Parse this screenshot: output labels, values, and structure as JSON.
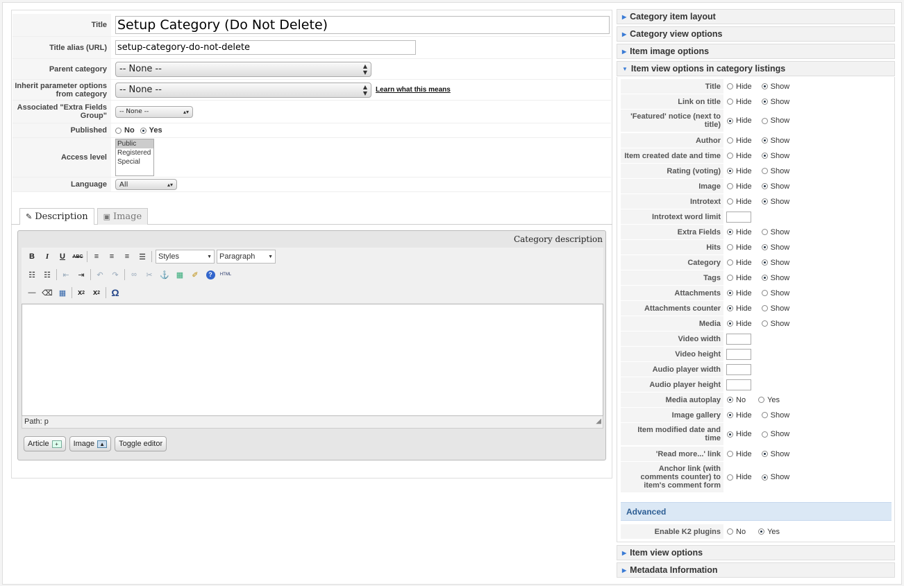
{
  "form": {
    "title_label": "Title",
    "title_value": "Setup Category (Do Not Delete)",
    "alias_label": "Title alias (URL)",
    "alias_value": "setup-category-do-not-delete",
    "parent_label": "Parent category",
    "parent_value": "-- None --",
    "inherit_label": "Inherit parameter options from category",
    "inherit_value": "-- None --",
    "learn_link": "Learn what this means",
    "extra_label": "Associated \"Extra Fields Group\"",
    "extra_value": "-- None --",
    "published_label": "Published",
    "published_no": "No",
    "published_yes": "Yes",
    "access_label": "Access level",
    "access_options": [
      "Public",
      "Registered",
      "Special"
    ],
    "language_label": "Language",
    "language_value": "All"
  },
  "tabs": {
    "description": "Description",
    "image": "Image"
  },
  "editor": {
    "heading": "Category description",
    "styles": "Styles",
    "format": "Paragraph",
    "path": "Path: p",
    "btn_article": "Article",
    "btn_image": "Image",
    "btn_toggle": "Toggle editor",
    "html_label": "HTML",
    "omega": "Ω"
  },
  "panels": {
    "item_layout": "Category item layout",
    "view_options": "Category view options",
    "image_options": "Item image options",
    "listing_options": "Item view options in category listings",
    "item_view": "Item view options",
    "metadata": "Metadata Information",
    "advanced": "Advanced"
  },
  "labels": {
    "hide": "Hide",
    "show": "Show",
    "no": "No",
    "yes": "Yes"
  },
  "listing_params": [
    {
      "label": "Title",
      "type": "hs",
      "value": "show"
    },
    {
      "label": "Link on title",
      "type": "hs",
      "value": "show"
    },
    {
      "label": "'Featured' notice (next to title)",
      "type": "hs",
      "value": "hide"
    },
    {
      "label": "Author",
      "type": "hs",
      "value": "show"
    },
    {
      "label": "Item created date and time",
      "type": "hs",
      "value": "show"
    },
    {
      "label": "Rating (voting)",
      "type": "hs",
      "value": "hide"
    },
    {
      "label": "Image",
      "type": "hs",
      "value": "show"
    },
    {
      "label": "Introtext",
      "type": "hs",
      "value": "show"
    },
    {
      "label": "Introtext word limit",
      "type": "input",
      "value": ""
    },
    {
      "label": "Extra Fields",
      "type": "hs",
      "value": "hide"
    },
    {
      "label": "Hits",
      "type": "hs",
      "value": "show"
    },
    {
      "label": "Category",
      "type": "hs",
      "value": "show"
    },
    {
      "label": "Tags",
      "type": "hs",
      "value": "show"
    },
    {
      "label": "Attachments",
      "type": "hs",
      "value": "hide"
    },
    {
      "label": "Attachments counter",
      "type": "hs",
      "value": "hide"
    },
    {
      "label": "Media",
      "type": "hs",
      "value": "hide"
    },
    {
      "label": "Video width",
      "type": "input",
      "value": ""
    },
    {
      "label": "Video height",
      "type": "input",
      "value": ""
    },
    {
      "label": "Audio player width",
      "type": "input",
      "value": ""
    },
    {
      "label": "Audio player height",
      "type": "input",
      "value": ""
    },
    {
      "label": "Media autoplay",
      "type": "ny",
      "value": "no"
    },
    {
      "label": "Image gallery",
      "type": "hs",
      "value": "hide"
    },
    {
      "label": "Item modified date and time",
      "type": "hs",
      "value": "hide"
    },
    {
      "label": "'Read more...' link",
      "type": "hs",
      "value": "show"
    },
    {
      "label": "Anchor link (with comments counter) to item's comment form",
      "type": "hs",
      "value": "show"
    }
  ],
  "advanced_params": [
    {
      "label": "Enable K2 plugins",
      "type": "ny",
      "value": "yes"
    }
  ]
}
